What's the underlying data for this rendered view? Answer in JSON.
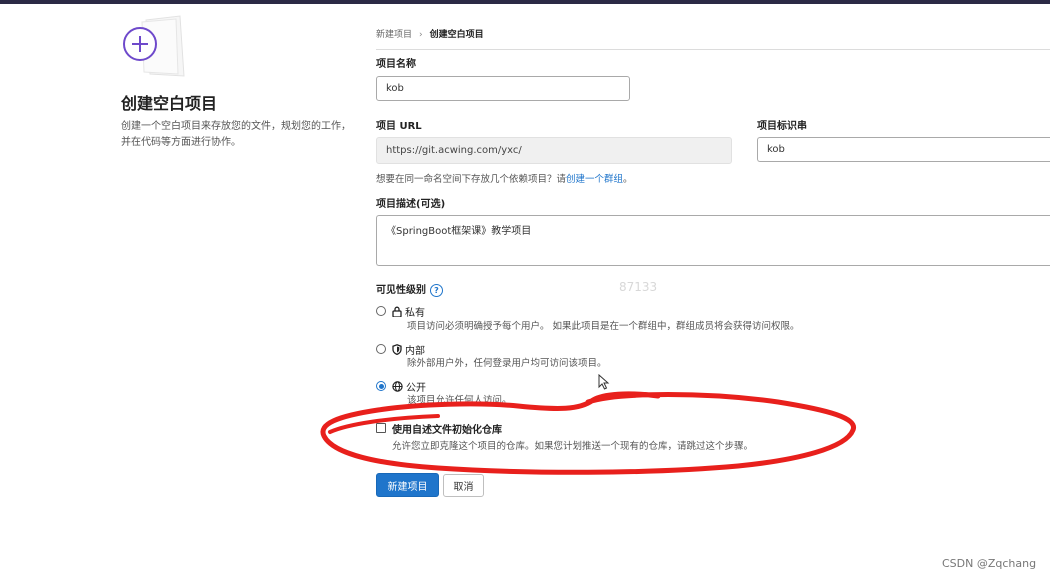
{
  "left_panel": {
    "title": "创建空白项目",
    "description": "创建一个空白项目来存放您的文件，规划您的工作，并在代码等方面进行协作。"
  },
  "breadcrumb": {
    "parent": "新建项目",
    "separator": "›",
    "current": "创建空白项目"
  },
  "form": {
    "project_name_label": "项目名称",
    "project_name_value": "kob",
    "project_url_label": "项目 URL",
    "project_url_value": "https://git.acwing.com/yxc/",
    "project_slug_label": "项目标识串",
    "project_slug_value": "kob",
    "namespace_hint_prefix": "想要在同一命名空间下存放几个依赖项目？请",
    "namespace_hint_link": "创建一个群组",
    "namespace_hint_suffix": "。",
    "description_label": "项目描述(可选)",
    "description_value": "《SpringBoot框架课》教学项目",
    "visibility_label": "可见性级别",
    "visibility_help_icon": "?",
    "visibility_options": [
      {
        "title": "私有",
        "icon": "lock-icon",
        "description": "项目访问必须明确授予每个用户。 如果此项目是在一个群组中，群组成员将会获得访问权限。",
        "selected": false
      },
      {
        "title": "内部",
        "icon": "shield-icon",
        "description": "除外部用户外，任何登录用户均可访问该项目。",
        "selected": false
      },
      {
        "title": "公开",
        "icon": "globe-icon",
        "description": "该项目允许任何人访问。",
        "selected": true
      }
    ],
    "readme_label": "使用自述文件初始化仓库",
    "readme_description": "允许您立即克隆这个项目的仓库。如果您计划推送一个现有的仓库，请跳过这个步骤。",
    "readme_checked": false,
    "create_button": "新建项目",
    "cancel_button": "取消"
  },
  "watermark_number": "87133",
  "footer_credit": "CSDN @Zqchang",
  "colors": {
    "accent": "#1f75cb",
    "annotation": "#e8201c",
    "top_bar": "#2b2a45",
    "illustration": "#6e49cb"
  }
}
